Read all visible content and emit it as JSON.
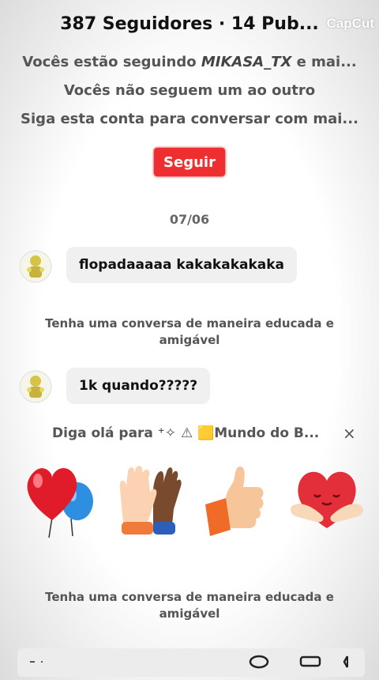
{
  "header": {
    "title": "387 Seguidores · 14 Pub...",
    "watermark": "CapCut"
  },
  "info": {
    "line1_prefix": "Vocês estão seguindo ",
    "line1_user": "MIKASA_TX",
    "line1_suffix": " e mai...",
    "line2": "Vocês não seguem um ao outro",
    "line3": "Siga esta conta para conversar com mai..."
  },
  "follow_button": "Seguir",
  "date": "07/06",
  "messages": [
    {
      "text": "flopadaaaaa kakakakakaka"
    },
    {
      "text": "1k quando?????"
    }
  ],
  "notice": "Tenha uma conversa de maneira educada e amigável",
  "greeting": "Diga olá para ⁺✧ ⚠ 🟨Mundo do B...",
  "close_symbol": "×",
  "stickers": [
    "heart-balloons-icon",
    "high-five-icon",
    "thumbs-up-icon",
    "heart-hug-icon"
  ],
  "colors": {
    "accent": "#ef2f2f"
  }
}
